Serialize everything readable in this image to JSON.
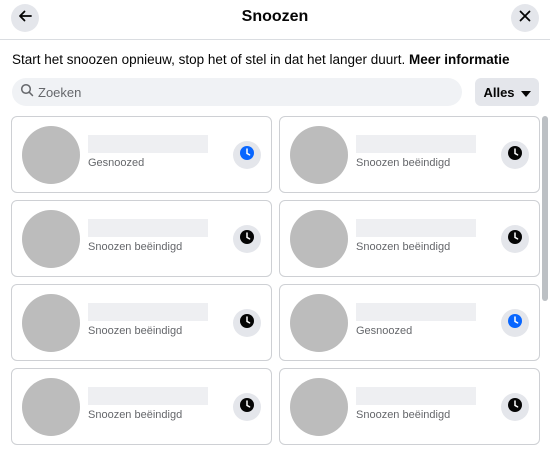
{
  "header": {
    "title": "Snoozen",
    "back_icon": "arrow-left-icon",
    "close_icon": "close-icon"
  },
  "info": {
    "text": "Start het snoozen opnieuw, stop het of stel in dat het langer duurt.",
    "link": "Meer informatie"
  },
  "search": {
    "placeholder": "Zoeken",
    "value": ""
  },
  "filter": {
    "label": "Alles"
  },
  "colors": {
    "accent": "#0866ff",
    "neutral_button": "#e4e6eb",
    "avatar_placeholder": "#bcbcbc",
    "name_placeholder": "#eeeff2"
  },
  "items": [
    {
      "status": "Gesnoozed",
      "icon": "clock-icon",
      "active": true
    },
    {
      "status": "Snoozen beëindigd",
      "icon": "clock-icon",
      "active": false
    },
    {
      "status": "Snoozen beëindigd",
      "icon": "clock-icon",
      "active": false
    },
    {
      "status": "Snoozen beëindigd",
      "icon": "clock-icon",
      "active": false
    },
    {
      "status": "Snoozen beëindigd",
      "icon": "clock-icon",
      "active": false
    },
    {
      "status": "Gesnoozed",
      "icon": "clock-icon",
      "active": true
    },
    {
      "status": "Snoozen beëindigd",
      "icon": "clock-icon",
      "active": false
    },
    {
      "status": "Snoozen beëindigd",
      "icon": "clock-icon",
      "active": false
    }
  ]
}
